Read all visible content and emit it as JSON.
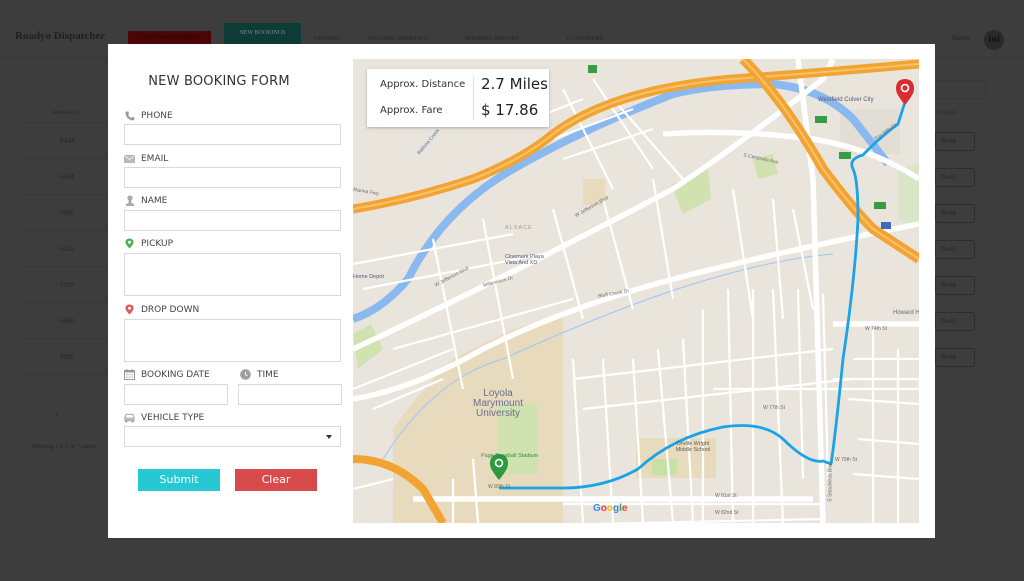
{
  "app": {
    "brand": "Roadyo Dispatcher",
    "nav": {
      "add_booking": "Add New Booking",
      "new_bookings": "New Bookings",
      "drivers": "Drivers",
      "ongoing_bookings": "Ongoing Bookings",
      "booking_history": "Booking History",
      "customers": "Customers"
    },
    "user": {
      "name": "Shreja",
      "avatar_text": "Ini"
    }
  },
  "background_table": {
    "id_header": "BOOKING ID",
    "status_header": "STATUS",
    "rows": [
      {
        "id": "6444",
        "action": "Book"
      },
      {
        "id": "6584",
        "action": "Book"
      },
      {
        "id": "5906",
        "action": "Book"
      },
      {
        "id": "6245",
        "action": "Book"
      },
      {
        "id": "5199",
        "action": "Book"
      },
      {
        "id": "6460",
        "action": "Book"
      },
      {
        "id": "6085",
        "action": "Book"
      }
    ],
    "pager": {
      "prev": "‹",
      "page": "1"
    },
    "showing": "Showing 1 to 7 of 7 entries"
  },
  "form": {
    "title": "NEW BOOKING FORM",
    "fields": {
      "phone": {
        "label": "PHONE",
        "value": "",
        "icon": "phone-icon"
      },
      "email": {
        "label": "EMAIL",
        "value": "",
        "icon": "envelope-icon"
      },
      "name": {
        "label": "NAME",
        "value": "",
        "icon": "user-icon"
      },
      "pickup": {
        "label": "PICKUP",
        "value": "",
        "icon": "pickup-pin-icon"
      },
      "dropoff": {
        "label": "DROP DOWN",
        "value": "",
        "icon": "dropoff-pin-icon"
      },
      "booking_date": {
        "label": "BOOKING DATE",
        "value": "",
        "icon": "calendar-icon"
      },
      "time": {
        "label": "TIME",
        "value": "",
        "icon": "clock-icon"
      },
      "vehicle_type": {
        "label": "VEHICLE TYPE",
        "selected": "",
        "icon": "car-icon"
      }
    },
    "submit_label": "Submit",
    "clear_label": "Clear",
    "colors": {
      "submit": "#26c9d3",
      "clear": "#d94a4a",
      "pickup": "#4caf50",
      "dropoff": "#e05555"
    }
  },
  "map": {
    "info": {
      "distance_label": "Approx. Distance",
      "distance_value": "2.7 Miles",
      "fare_label": "Approx. Fare",
      "fare_value": "$ 17.86"
    },
    "labels": {
      "westfield": "Westfield Culver City",
      "lmu": "Loyola Marymount University",
      "stadium": "Page Baseball Stadium",
      "orville": "Orville Wright Middle School",
      "cinemark": "Cinemark Playa Vista And XD",
      "home_depot": "Home Depot",
      "alsace": "ALSACE",
      "jefferson1": "W Jefferson Blvd",
      "jefferson2": "W Jefferson Blvd",
      "centinela": "S Centinela Ave",
      "bluff": "Bluff Creek Dr",
      "ballona": "Ballona Creek",
      "marina": "Marina Fwy",
      "w80th": "W 80th St",
      "w79th": "W 79th St",
      "w77th": "W 77th St",
      "w74th": "W 74th St",
      "w81st": "W 81st St",
      "w82nd": "W 82nd St",
      "sepulveda": "S Sepulveda Blvd",
      "howard": "Howard Hughes Pkwy",
      "millennium": "Millennium Dr",
      "fox_hills": "Fox Hills Dr"
    },
    "route_color": "#1aa3e8",
    "google_logo": [
      "G",
      "o",
      "o",
      "g",
      "l",
      "e"
    ]
  }
}
